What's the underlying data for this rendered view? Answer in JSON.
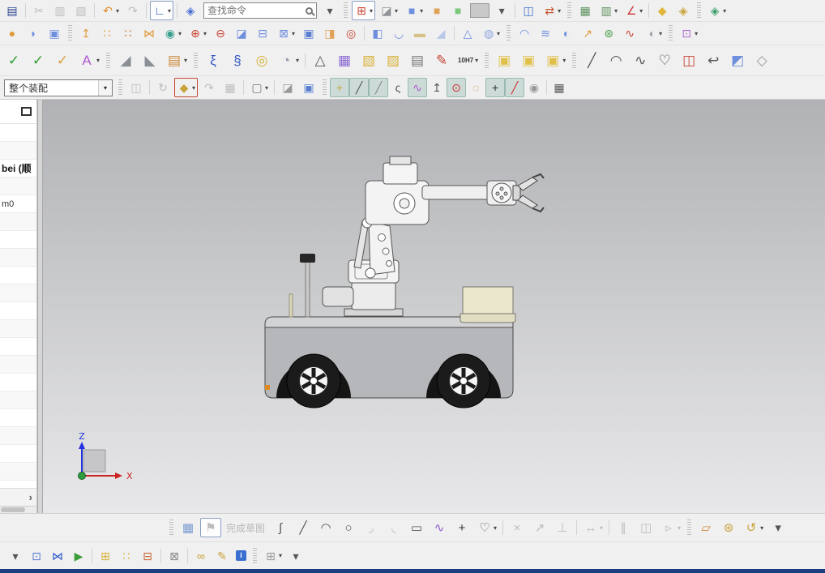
{
  "ui": {
    "dropdown_glyph": "▾"
  },
  "search": {
    "name": "command-finder-input",
    "placeholder": "查找命令"
  },
  "toolbar_standard": {
    "items": [
      {
        "name": "save-button",
        "g": "▤",
        "c": "#28418e"
      },
      {
        "t": "sep"
      },
      {
        "name": "cut-button",
        "g": "✂",
        "c": "#999",
        "dis": 1
      },
      {
        "name": "copy-button",
        "g": "▥",
        "c": "#999",
        "dis": 1
      },
      {
        "name": "paste-button",
        "g": "▧",
        "c": "#999",
        "dis": 1
      },
      {
        "t": "sep"
      },
      {
        "name": "undo-button",
        "g": "↶",
        "c": "#e08a1e",
        "dd": 1
      },
      {
        "name": "redo-button",
        "g": "↷",
        "c": "#b0b0b0",
        "dis": 1
      },
      {
        "t": "sep"
      },
      {
        "name": "orient-view-button",
        "g": "∟",
        "c": "#2855c8",
        "box": 1,
        "dd": 1
      },
      {
        "t": "sep"
      },
      {
        "name": "datum-display-button",
        "g": "◈",
        "c": "#4a6fd4"
      },
      {
        "t": "search"
      },
      {
        "name": "search-options-dropdown",
        "g": "▾",
        "c": "#555"
      },
      {
        "t": "grip"
      },
      {
        "name": "fit-view-button",
        "g": "⊞",
        "c": "#c84433",
        "box": 1,
        "dd": 1
      },
      {
        "name": "view-orientation-button",
        "g": "◪",
        "c": "#8f9296",
        "dd": 1
      },
      {
        "name": "shaded-view-button",
        "g": "■",
        "c": "#6e8ede",
        "dd": 1
      },
      {
        "name": "shaded-edges-view-button",
        "g": "■",
        "c": "#e0a35a"
      },
      {
        "name": "section-view-button",
        "g": "■",
        "c": "#7cc87c"
      },
      {
        "t": "swatch",
        "name": "background-color-swatch"
      },
      {
        "name": "background-dropdown",
        "g": "▾",
        "c": "#555"
      },
      {
        "t": "sep"
      },
      {
        "name": "new-window-button",
        "g": "◫",
        "c": "#3a6fd0"
      },
      {
        "name": "arrange-windows-button",
        "g": "⇄",
        "c": "#c85533",
        "dd": 1
      },
      {
        "t": "grip"
      },
      {
        "name": "layer-settings-button",
        "g": "▦",
        "c": "#5a8f5a"
      },
      {
        "name": "move-to-layer-button",
        "g": "▥",
        "c": "#5a8f5a",
        "dd": 1
      },
      {
        "name": "wcs-display-button",
        "g": "∠",
        "c": "#cc3333",
        "dd": 1
      },
      {
        "t": "sep"
      },
      {
        "name": "show-hide-button",
        "g": "◆",
        "c": "#e0b63a"
      },
      {
        "name": "role-button",
        "g": "◈",
        "c": "#caa23a"
      },
      {
        "t": "grip"
      },
      {
        "name": "touch-mode-button",
        "g": "◈",
        "c": "#3aa06a",
        "dd": 1
      }
    ]
  },
  "toolbar_feature": {
    "items": [
      {
        "name": "boss-button",
        "g": "●",
        "c": "#e09a3a"
      },
      {
        "name": "revolve-button",
        "g": "◗",
        "c": "#6e8ede"
      },
      {
        "name": "pocket-button",
        "g": "▣",
        "c": "#6e8ede"
      },
      {
        "t": "grip"
      },
      {
        "name": "extrude-button",
        "g": "↥",
        "c": "#e09a3a"
      },
      {
        "name": "pattern-feature-button",
        "g": "∷",
        "c": "#e09a3a"
      },
      {
        "name": "pattern-geometry-button",
        "g": "∷",
        "c": "#c87733"
      },
      {
        "name": "mirror-feature-button",
        "g": "⋈",
        "c": "#e09a3a"
      },
      {
        "name": "boolean-button",
        "g": "◉",
        "c": "#3a9e8e",
        "dd": 1
      },
      {
        "name": "unite-button",
        "g": "⊕",
        "c": "#c84433",
        "dd": 1
      },
      {
        "name": "subtract-button",
        "g": "⊖",
        "c": "#c84433"
      },
      {
        "name": "trim-body-button",
        "g": "◪",
        "c": "#6e8ede"
      },
      {
        "name": "split-body-button",
        "g": "⊟",
        "c": "#6e8ede"
      },
      {
        "name": "cavity-button",
        "g": "⊠",
        "c": "#6e8ede",
        "dd": 1
      },
      {
        "name": "emboss-body-button",
        "g": "▣",
        "c": "#5a7fd0"
      },
      {
        "name": "thicken-button",
        "g": "◨",
        "c": "#e0a35a"
      },
      {
        "name": "wrap-geometry-button",
        "g": "◎",
        "c": "#c84433"
      },
      {
        "t": "sep"
      },
      {
        "name": "pad-button",
        "g": "◧",
        "c": "#6e8ede"
      },
      {
        "name": "flange-button",
        "g": "◡",
        "c": "#6e8ede"
      },
      {
        "name": "bend-button",
        "g": "▬",
        "c": "#d8c08a"
      },
      {
        "name": "tab-button",
        "g": "◢",
        "c": "#b8c8e8"
      },
      {
        "t": "sep"
      },
      {
        "name": "convex-pyramid-button",
        "g": "△",
        "c": "#6e8ede"
      },
      {
        "name": "faceted-body-button",
        "g": "◍",
        "c": "#8ea8e0",
        "dd": 1
      },
      {
        "t": "grip"
      },
      {
        "name": "ruled-surface-button",
        "g": "◠",
        "c": "#6e8ede"
      },
      {
        "name": "through-curves-button",
        "g": "≋",
        "c": "#6e8ede"
      },
      {
        "name": "bounded-plane-button",
        "g": "◐",
        "c": "#6e8ede"
      },
      {
        "name": "swept-surface-button",
        "g": "↗",
        "c": "#e09a3a"
      },
      {
        "name": "curve-network-button",
        "g": "⊛",
        "c": "#4a9e4a"
      },
      {
        "name": "flow-surface-button",
        "g": "∿",
        "c": "#c84433"
      },
      {
        "name": "sheet-body-button",
        "g": "◖",
        "c": "#9aa0a8",
        "dd": 1
      },
      {
        "t": "grip"
      },
      {
        "name": "move-face-button",
        "g": "⊡",
        "c": "#b06ad0",
        "dd": 1
      }
    ]
  },
  "toolbar_check": {
    "items": [
      {
        "name": "examine-geometry-button",
        "g": "✓",
        "c": "#2f9e2f"
      },
      {
        "name": "verify-feature-button",
        "g": "✓",
        "c": "#2f9e2f"
      },
      {
        "name": "check-body-button",
        "g": "✓",
        "c": "#d8a23a"
      },
      {
        "name": "text-feature-button",
        "g": "A",
        "c": "#b05ad0",
        "dd": 1
      },
      {
        "t": "grip"
      },
      {
        "name": "draft-button",
        "g": "◢",
        "c": "#8a8f96"
      },
      {
        "name": "draft-body-button",
        "g": "◣",
        "c": "#8a8f96"
      },
      {
        "name": "feature-playback-button",
        "g": "▤",
        "c": "#cc8a3a",
        "dd": 1
      },
      {
        "t": "grip"
      },
      {
        "name": "helix-button",
        "g": "ξ",
        "c": "#3558c8"
      },
      {
        "name": "spring-button",
        "g": "§",
        "c": "#3558c8"
      },
      {
        "name": "torus-button",
        "g": "◎",
        "c": "#d8b23a"
      },
      {
        "name": "strainer-button",
        "g": "◔",
        "c": "#9999aa",
        "dd": 1
      },
      {
        "t": "sep"
      },
      {
        "name": "draft-analysis-button",
        "g": "△",
        "c": "#555"
      },
      {
        "name": "part-family-table-button",
        "g": "▦",
        "c": "#8a6ad0"
      },
      {
        "name": "point-set-folder-button",
        "g": "▧",
        "c": "#d8b23a"
      },
      {
        "name": "group-folder-button",
        "g": "▨",
        "c": "#d8b23a"
      },
      {
        "name": "annotation-note-button",
        "g": "▤",
        "c": "#777"
      },
      {
        "name": "dimension-style-button",
        "g": "✎",
        "c": "#c84433"
      },
      {
        "name": "tolerance-search-button",
        "g": "10H7",
        "c": "#333",
        "cls": "tiny",
        "dd": 1
      },
      {
        "t": "grip"
      },
      {
        "name": "locked-feature-button",
        "g": "▣",
        "c": "#e0c04a"
      },
      {
        "name": "locked-group-button",
        "g": "▣",
        "c": "#e0c04a"
      },
      {
        "name": "locked-body-button",
        "g": "▣",
        "c": "#e0c04a",
        "dd": 1
      },
      {
        "t": "grip"
      },
      {
        "name": "line-curve-button",
        "g": "╱",
        "c": "#555"
      },
      {
        "name": "arc-curve-button",
        "g": "◠",
        "c": "#555"
      },
      {
        "name": "fit-curve-button",
        "g": "∿",
        "c": "#555"
      },
      {
        "name": "offset-curve-button",
        "g": "♡",
        "c": "#333"
      },
      {
        "name": "offset-surface-button",
        "g": "◫",
        "c": "#c84433"
      },
      {
        "name": "combined-projection-button",
        "g": "↩",
        "c": "#555"
      },
      {
        "name": "project-curve-button",
        "g": "◩",
        "c": "#6e8ede"
      },
      {
        "name": "isocurve-button",
        "g": "◇",
        "c": "#999"
      }
    ]
  },
  "toolbar_assembly": {
    "scope_value": "整个装配",
    "items": [
      {
        "t": "combo",
        "name": "assembly-scope-combo"
      },
      {
        "t": "grip"
      },
      {
        "name": "find-in-assembly-button",
        "g": "◫",
        "c": "#999",
        "dis": 1
      },
      {
        "t": "sep"
      },
      {
        "name": "replace-component-button",
        "g": "↻",
        "c": "#999",
        "dis": 1
      },
      {
        "name": "selection-filter-button",
        "g": "◆",
        "c": "#c8a23a",
        "red": 1,
        "dd": 1
      },
      {
        "name": "remember-constraints-button",
        "g": "↷",
        "c": "#999",
        "dis": 1
      },
      {
        "name": "pattern-component-button",
        "g": "▦",
        "c": "#999",
        "dis": 1
      },
      {
        "t": "sep"
      },
      {
        "name": "marquee-select-button",
        "g": "▢",
        "c": "#777",
        "dd": 1
      },
      {
        "t": "sep"
      },
      {
        "name": "deselect-all-button",
        "g": "◪",
        "c": "#999"
      },
      {
        "name": "work-section-button",
        "g": "▣",
        "c": "#5a7fd0"
      },
      {
        "t": "grip"
      },
      {
        "name": "snap-point-toggle",
        "g": "+",
        "c": "#caa23a",
        "on": 1,
        "cls": "tglb"
      },
      {
        "name": "end-point-toggle",
        "g": "╱",
        "c": "#555",
        "on": 1,
        "cls": "tglb"
      },
      {
        "name": "mid-point-toggle",
        "g": "╱",
        "c": "#888",
        "on": 1,
        "cls": "tglb"
      },
      {
        "name": "control-point-toggle",
        "g": "ς",
        "c": "#555",
        "cls": "tglb"
      },
      {
        "name": "pole-point-toggle",
        "g": "∿",
        "c": "#b05ad0",
        "on": 1,
        "cls": "tglb"
      },
      {
        "name": "intersection-point-toggle",
        "g": "↥",
        "c": "#555",
        "cls": "tglb"
      },
      {
        "name": "arc-center-toggle",
        "g": "⊙",
        "c": "#cc3333",
        "on": 1,
        "cls": "tglb"
      },
      {
        "name": "quadrant-point-toggle",
        "g": "◌",
        "c": "#cc8833",
        "cls": "tglb"
      },
      {
        "name": "existing-point-toggle",
        "g": "+",
        "c": "#333",
        "on": 1,
        "cls": "tglb"
      },
      {
        "name": "point-on-curve-toggle",
        "g": "╱",
        "c": "#cc3333",
        "on": 1,
        "cls": "tglb"
      },
      {
        "name": "point-on-surface-toggle",
        "g": "◉",
        "c": "#999",
        "cls": "tglb"
      },
      {
        "t": "sep"
      },
      {
        "name": "grid-point-toggle",
        "g": "▦",
        "c": "#555",
        "cls": "tglb"
      }
    ]
  },
  "sketch_toolbar": {
    "finish_label": "完成草图",
    "items": [
      {
        "t": "grip"
      },
      {
        "name": "direct-sketch-button",
        "g": "▦",
        "c": "#7a9ad0"
      },
      {
        "name": "finish-sketch-button",
        "g": "⚑",
        "c": "#999",
        "dis": 1,
        "box": 1
      },
      {
        "t": "label",
        "name": "finish-sketch-label",
        "text": "完成草图",
        "dis": 1
      },
      {
        "name": "profile-button",
        "g": "∫",
        "c": "#555"
      },
      {
        "name": "line-button",
        "g": "╱",
        "c": "#555"
      },
      {
        "name": "arc-button",
        "g": "◠",
        "c": "#555"
      },
      {
        "name": "circle-button",
        "g": "○",
        "c": "#555"
      },
      {
        "name": "fillet-button",
        "g": "◞",
        "c": "#bbb",
        "dis": 1
      },
      {
        "name": "chamfer-button",
        "g": "◟",
        "c": "#bbb",
        "dis": 1
      },
      {
        "name": "rectangle-button",
        "g": "▭",
        "c": "#555"
      },
      {
        "name": "studio-spline-button",
        "g": "∿",
        "c": "#8a5ad0"
      },
      {
        "name": "point-button",
        "g": "+",
        "c": "#333"
      },
      {
        "name": "offset-curve-sketch-button",
        "g": "♡",
        "c": "#555",
        "dd": 1
      },
      {
        "t": "sep"
      },
      {
        "name": "quick-trim-button",
        "g": "×",
        "c": "#6a8f6a",
        "dis": 1
      },
      {
        "name": "quick-extend-button",
        "g": "↗",
        "c": "#6a8f6a",
        "dis": 1
      },
      {
        "name": "make-corner-button",
        "g": "⊥",
        "c": "#888",
        "dis": 1
      },
      {
        "t": "sep"
      },
      {
        "name": "rapid-dimension-button",
        "g": "↔",
        "c": "#888",
        "dis": 1,
        "dd": 1
      },
      {
        "t": "sep"
      },
      {
        "name": "geometric-constraints-button",
        "g": "∥",
        "c": "#888",
        "dis": 1
      },
      {
        "name": "make-symmetric-button",
        "g": "◫",
        "c": "#888",
        "dis": 1
      },
      {
        "name": "display-constraints-button",
        "g": "▹",
        "c": "#888",
        "dis": 1,
        "dd": 1
      },
      {
        "t": "grip"
      },
      {
        "name": "convert-to-reference-button",
        "g": "▱",
        "c": "#cc8a3a"
      },
      {
        "name": "pattern-curve-button",
        "g": "⊛",
        "c": "#caa23a"
      },
      {
        "name": "reattach-button",
        "g": "↺",
        "c": "#caa23a",
        "dd": 1
      },
      {
        "name": "sketch-toolbar-overflow",
        "g": "▾",
        "c": "#555"
      }
    ]
  },
  "assembly_toolbar2": {
    "items": [
      {
        "name": "assembly-overflow-dropdown",
        "g": "▾",
        "c": "#555"
      },
      {
        "name": "move-component-button",
        "g": "⊡",
        "c": "#5a7fd0"
      },
      {
        "name": "mirror-assembly-button",
        "g": "⋈",
        "c": "#2855c8"
      },
      {
        "name": "constraint-playback-button",
        "g": "▶",
        "c": "#3a9e3a"
      },
      {
        "t": "sep"
      },
      {
        "name": "assembly-constraints-button",
        "g": "⊞",
        "c": "#d8b23a"
      },
      {
        "name": "add-component-button",
        "g": "∷",
        "c": "#d8b23a"
      },
      {
        "name": "pattern-components-button",
        "g": "⊟",
        "c": "#c86633"
      },
      {
        "t": "sep"
      },
      {
        "name": "exploded-views-button",
        "g": "⊠",
        "c": "#888"
      },
      {
        "t": "sep"
      },
      {
        "name": "interpart-link-button",
        "g": "∞",
        "c": "#caa23a"
      },
      {
        "name": "wave-geometry-linker-button",
        "g": "✎",
        "c": "#caa23a"
      },
      {
        "name": "part-information-button",
        "g": "i",
        "c": "#fff",
        "cls": "infobox"
      },
      {
        "t": "grip"
      },
      {
        "name": "assembly-cut-button",
        "g": "⊞",
        "c": "#999",
        "dd": 1
      },
      {
        "name": "assembly-overflow-2",
        "g": "▾",
        "c": "#555"
      }
    ]
  },
  "left_panel": {
    "rows": [
      {
        "text": ""
      },
      {
        "text": ""
      },
      {
        "text": "bei (顺",
        "bold": true
      },
      {
        "text": ""
      },
      {
        "text": "m0"
      }
    ],
    "empty_row_count": 15,
    "expand_chevron": "›"
  },
  "viewport": {
    "triad": {
      "z_label": "Z",
      "x_label": "X"
    }
  }
}
